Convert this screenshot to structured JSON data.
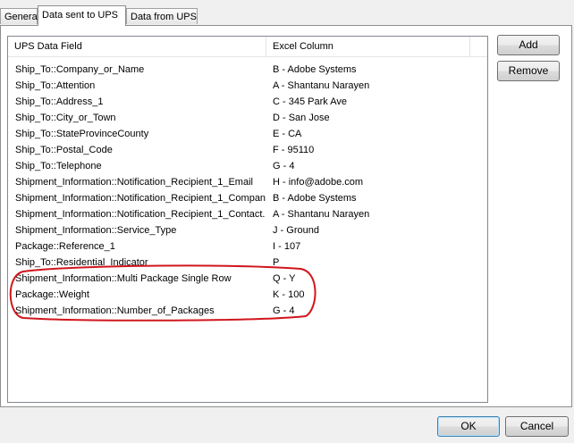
{
  "tabs": [
    {
      "label": "General",
      "active": false
    },
    {
      "label": "Data sent to UPS",
      "active": true
    },
    {
      "label": "Data from UPS",
      "active": false
    }
  ],
  "list": {
    "columns": [
      "UPS Data Field",
      "Excel Column"
    ],
    "rows": [
      {
        "field": "Ship_To::Company_or_Name",
        "column": "B - Adobe Systems"
      },
      {
        "field": "Ship_To::Attention",
        "column": "A - Shantanu Narayen"
      },
      {
        "field": "Ship_To::Address_1",
        "column": "C - 345 Park Ave"
      },
      {
        "field": "Ship_To::City_or_Town",
        "column": "D - San Jose"
      },
      {
        "field": "Ship_To::StateProvinceCounty",
        "column": "E - CA"
      },
      {
        "field": "Ship_To::Postal_Code",
        "column": "F - 95110"
      },
      {
        "field": "Ship_To::Telephone",
        "column": "G - 4"
      },
      {
        "field": "Shipment_Information::Notification_Recipient_1_Email",
        "column": "H - info@adobe.com"
      },
      {
        "field": "Shipment_Information::Notification_Recipient_1_Compan...",
        "column": "B - Adobe Systems"
      },
      {
        "field": "Shipment_Information::Notification_Recipient_1_Contact...",
        "column": "A - Shantanu Narayen"
      },
      {
        "field": "Shipment_Information::Service_Type",
        "column": "J - Ground"
      },
      {
        "field": "Package::Reference_1",
        "column": "I - 107"
      },
      {
        "field": "Ship_To::Residential_Indicator",
        "column": "P"
      },
      {
        "field": "Shipment_Information::Multi Package Single Row",
        "column": "Q - Y"
      },
      {
        "field": "Package::Weight",
        "column": "K - 100"
      },
      {
        "field": "Shipment_Information::Number_of_Packages",
        "column": "G - 4"
      }
    ]
  },
  "buttons": {
    "add": "Add",
    "remove": "Remove",
    "ok": "OK",
    "cancel": "Cancel"
  },
  "colors": {
    "annotation": "#d0161c",
    "selection_border": "#3c7fb1"
  }
}
